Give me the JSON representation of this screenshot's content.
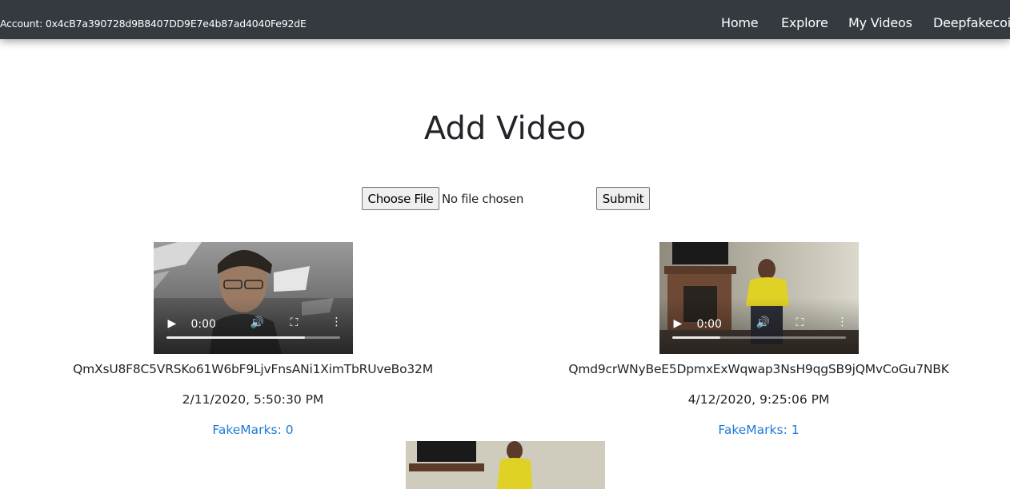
{
  "navbar": {
    "account": "Account: 0x4cB7a390728d9B8407DD9E7e4b87ad4040Fe92dE",
    "links": [
      "Home",
      "Explore",
      "My Videos",
      "Deepfakecoin"
    ]
  },
  "page": {
    "title": "Add Video"
  },
  "upload": {
    "choose_label": "Choose File",
    "file_status": "No file chosen",
    "submit_label": "Submit"
  },
  "videos": [
    {
      "time": "0:00",
      "hash": "QmXsU8F8C5VRSKo61W6bF9LjvFnsANi1XimTbRUveBo32M",
      "date": "2/11/2020, 5:50:30 PM",
      "fakemarks": "FakeMarks: 0",
      "progress": 0.8
    },
    {
      "time": "0:00",
      "hash": "Qmd9crWNyBeE5DpmxExWqwap3NsH9qgSB9jQMvCoGu7NBK",
      "date": "4/12/2020, 9:25:06 PM",
      "fakemarks": "FakeMarks: 1",
      "progress": 0.28
    }
  ],
  "icons": {
    "play": "play-icon",
    "volume": "volume-icon",
    "fullscreen": "fullscreen-icon",
    "more": "more-options-icon"
  },
  "colors": {
    "navbar_bg": "#343a40",
    "link": "#1e7ad6"
  }
}
